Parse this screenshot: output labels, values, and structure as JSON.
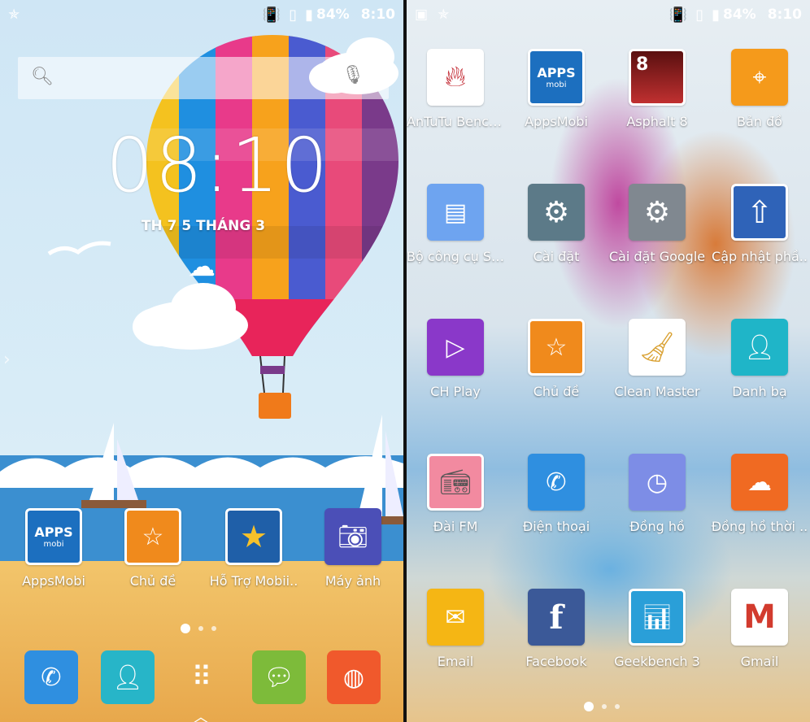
{
  "left": {
    "status": {
      "battery": "84%",
      "time": "8:10"
    },
    "clock": {
      "time": "08:10",
      "date": "TH 7 5 THÁNG 3"
    },
    "apps": [
      {
        "label": "AppsMobi",
        "icon": "appsmobi-icon",
        "color": "#1c6fbf"
      },
      {
        "label": "Chủ đề",
        "icon": "theme-star-icon",
        "color": "#f08a1c"
      },
      {
        "label": "Hỗ Trợ Mobii..",
        "icon": "support-star-icon",
        "color": "#1f5fa8"
      },
      {
        "label": "Máy ảnh",
        "icon": "camera-icon",
        "color": "#4b4fb7"
      }
    ],
    "dock": [
      {
        "icon": "phone-icon",
        "color": "#2f8fe0"
      },
      {
        "icon": "contacts-icon",
        "color": "#27b5c8"
      },
      {
        "icon": "app-drawer-icon",
        "color": "transparent"
      },
      {
        "icon": "messages-icon",
        "color": "#7dbb3a"
      },
      {
        "icon": "browser-icon",
        "color": "#f0592c"
      }
    ]
  },
  "right": {
    "status": {
      "battery": "84%",
      "time": "8:10"
    },
    "apps": [
      {
        "label": "AnTuTu Bench..",
        "icon": "antutu-icon",
        "color": "#c0202a"
      },
      {
        "label": "AppsMobi",
        "icon": "appsmobi-icon",
        "color": "#1c6fbf"
      },
      {
        "label": "Asphalt 8",
        "icon": "asphalt-icon",
        "color": "#7a1a1a"
      },
      {
        "label": "Bản đồ",
        "icon": "map-pin-icon",
        "color": "#f59a1b"
      },
      {
        "label": "Bộ công cụ SIM",
        "icon": "sim-icon",
        "color": "#6ea4f0"
      },
      {
        "label": "Cài đặt",
        "icon": "settings-gear-icon",
        "color": "#5c7a88"
      },
      {
        "label": "Cài đặt Google",
        "icon": "google-settings-icon",
        "color": "#808890"
      },
      {
        "label": "Cập nhật phầ..",
        "icon": "update-arrow-icon",
        "color": "#2f63b8"
      },
      {
        "label": "CH Play",
        "icon": "play-store-icon",
        "color": "#8a38c9"
      },
      {
        "label": "Chủ đề",
        "icon": "theme-star-icon",
        "color": "#f08a1c"
      },
      {
        "label": "Clean Master",
        "icon": "broom-icon",
        "color": "#ffffff"
      },
      {
        "label": "Danh bạ",
        "icon": "contacts-icon",
        "color": "#1fb5c8"
      },
      {
        "label": "Đài FM",
        "icon": "radio-icon",
        "color": "#f28aa0"
      },
      {
        "label": "Điện thoại",
        "icon": "phone-icon",
        "color": "#2f8fe0"
      },
      {
        "label": "Đồng hồ",
        "icon": "clock-icon",
        "color": "#7d8de6"
      },
      {
        "label": "Đồng hồ thời ..",
        "icon": "weather-clock-icon",
        "color": "#f06a22"
      },
      {
        "label": "Email",
        "icon": "email-icon",
        "color": "#f5b614"
      },
      {
        "label": "Facebook",
        "icon": "facebook-icon",
        "color": "#3b5998"
      },
      {
        "label": "Geekbench 3",
        "icon": "geekbench-icon",
        "color": "#2a9fd8"
      },
      {
        "label": "Gmail",
        "icon": "gmail-icon",
        "color": "#ffffff"
      }
    ]
  },
  "texts": {
    "apps_badge": "APPS",
    "apps_sub": "mobi",
    "asphalt_num": "8"
  }
}
